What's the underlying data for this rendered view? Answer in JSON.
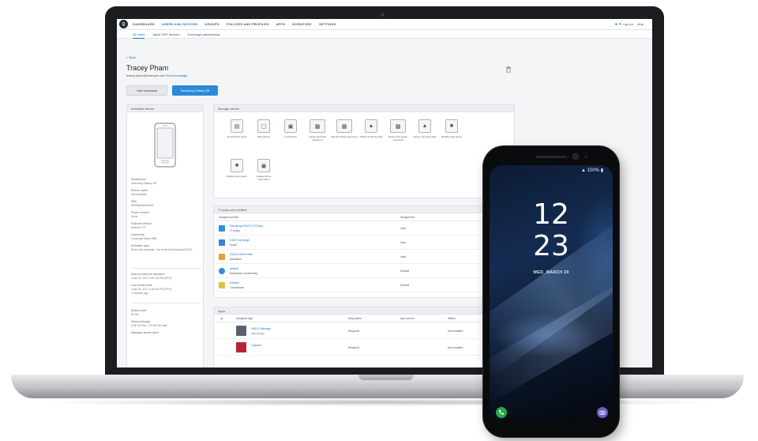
{
  "app": {
    "logo_text": "Q",
    "nav": [
      "DASHBOARD",
      "USERS AND DEVICES",
      "GROUPS",
      "POLICIES AND PROFILES",
      "APPS",
      "INVENTORY",
      "SETTINGS"
    ],
    "top_right": {
      "login": "Log out",
      "help": "Help"
    },
    "subtabs": [
      "All users",
      "Apple DEP devices",
      "Exchange gatekeeping"
    ]
  },
  "header": {
    "back": "< Back",
    "user_name": "Tracey Pham",
    "email_line": "tracey.pham@example.com",
    "email_link": "Send message",
    "btn_summary": "User summary",
    "btn_samsung": "Samsung Galaxy S8"
  },
  "left_panel": {
    "title": "Activated device",
    "fields": [
      {
        "label": "Smartphone",
        "value": "Samsung Galaxy S8"
      },
      {
        "label": "Device owner",
        "value": "Not available"
      },
      {
        "label": "IMEI",
        "value": "352088080000000"
      },
      {
        "label": "Phone number",
        "value": "None"
      },
      {
        "label": "Software version",
        "value": "Android 7.0"
      },
      {
        "label": "Ownership",
        "value": "Corporate-liable",
        "link": "Edit"
      },
      {
        "label": "Activation type",
        "value": "Work and personal - full control (Samsung KNOX)"
      }
    ],
    "dates": [
      {
        "label": "Date provided for activation",
        "value": "June 22, 2017 3:57:00 PM (EDT)"
      },
      {
        "label": "Last contact time",
        "value": "June 28, 2017 4:46:45 PM (EDT)",
        "extra": "2 minutes ago"
      }
    ],
    "extra": [
      {
        "label": "Battery level",
        "value": "85.0%"
      },
      {
        "label": "Internal storage",
        "value": "8.56 GB free / 23.96 GB total"
      },
      {
        "label": "Managed device client",
        "value": ""
      }
    ]
  },
  "manage": {
    "title": "Manage device",
    "actions": [
      "Send device report",
      "Wipe device",
      "Lock device",
      "Unlock and clear password",
      "Specify device password",
      "Delete all device data",
      "Reset work space password",
      "Delete only work data",
      "Disable work space",
      "Enable work space",
      "Update device information"
    ]
  },
  "policies": {
    "title": "IT policy and profiles",
    "col_name": "Assigned profile",
    "col_assign": "Assignment",
    "rows": [
      {
        "name": "Samsung KNOX IT Policy",
        "sub": "IT policy",
        "assign": "User",
        "color": "#2f8fd8"
      },
      {
        "name": "EAS Exchange",
        "sub": "Email",
        "assign": "User",
        "color": "#3d7fd2"
      },
      {
        "name": "KNOX Wifi Profile",
        "sub": "Activation",
        "assign": "User",
        "color": "#e0a52a"
      },
      {
        "name": "default",
        "sub": "Enterprise connectivity",
        "assign": "Default",
        "color": "#2f8fd8"
      },
      {
        "name": "Default",
        "sub": "Compliance",
        "assign": "Default",
        "color": "#e0c23a"
      }
    ]
  },
  "apps": {
    "title": "Apps",
    "col_name": "Assigned app",
    "col_disp": "Disposition",
    "col_source": "App source",
    "col_status": "Status",
    "rows": [
      {
        "name": "KNOX Manage",
        "sub": "Internal app",
        "disp": "Required",
        "status": "Not installed",
        "color": "#5a6270"
      },
      {
        "name": "Capture",
        "sub": "",
        "disp": "Required",
        "status": "Not installed",
        "color": "#b8233a"
      }
    ]
  },
  "phone": {
    "status": "100%",
    "hour": "12",
    "minute": "23",
    "date": "WED, MARCH 29"
  }
}
